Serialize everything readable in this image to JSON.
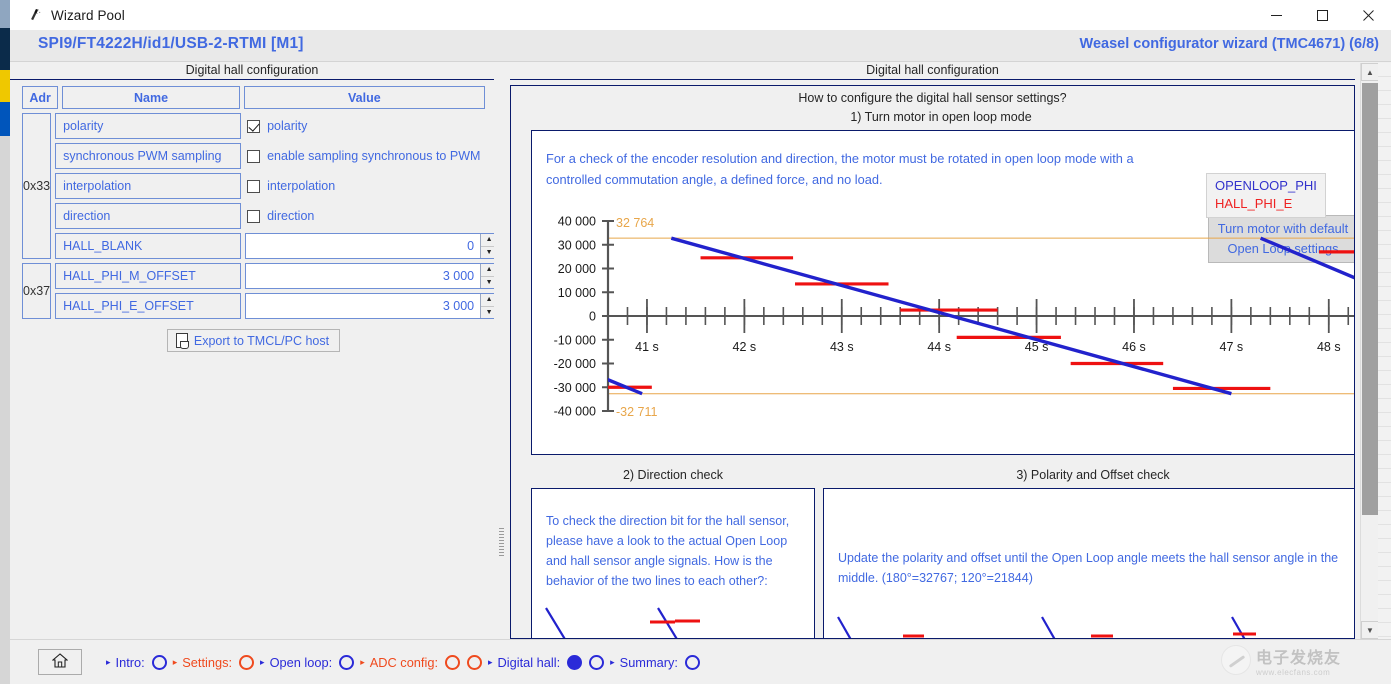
{
  "window": {
    "title": "Wizard Pool",
    "icon": "wand-icon",
    "minimize": "—",
    "maximize": "☐",
    "close": "✕"
  },
  "header": {
    "device": "SPI9/FT4222H/id1/USB-2-RTMI [M1]",
    "wizard": "Weasel configurator wizard (TMC4671) (6/8)"
  },
  "left_panel": {
    "group_title": "Digital hall configuration",
    "columns": {
      "adr": "Adr",
      "name": "Name",
      "value": "Value"
    },
    "groups": [
      {
        "adr": "0x33",
        "rows": [
          {
            "name": "polarity",
            "type": "checkbox",
            "label": "polarity",
            "checked": true
          },
          {
            "name": "synchronous PWM sampling",
            "type": "checkbox",
            "label": "enable sampling synchronous to PWM",
            "checked": false
          },
          {
            "name": "interpolation",
            "type": "checkbox",
            "label": "interpolation",
            "checked": false
          },
          {
            "name": "direction",
            "type": "checkbox",
            "label": "direction",
            "checked": false
          },
          {
            "name": "HALL_BLANK",
            "type": "spin",
            "value": "0"
          }
        ]
      },
      {
        "adr": "0x37",
        "rows": [
          {
            "name": "HALL_PHI_M_OFFSET",
            "type": "spin",
            "value": "3 000"
          },
          {
            "name": "HALL_PHI_E_OFFSET",
            "type": "spin",
            "value": "3 000"
          }
        ]
      }
    ],
    "export_button": "Export to TMCL/PC host",
    "spin_up": "▲",
    "spin_down": "▼"
  },
  "right_panel": {
    "group_title": "Digital hall configuration",
    "how_title": "How to configure the digital hall sensor settings?",
    "section1": {
      "label": "1) Turn motor in open loop mode",
      "text": "For a check of the encoder resolution and direction, the motor must be rotated in open loop mode with a controlled commutation angle, a defined force, and no load.",
      "button_line1": "Turn motor with default",
      "button_line2": "Open Loop settings"
    },
    "section2": {
      "label": "2) Direction check",
      "text": "To check the direction bit for the hall sensor, please have a look to the actual Open Loop and hall sensor angle signals. How is the behavior of the two lines to each other?:"
    },
    "section3": {
      "label": "3) Polarity and Offset check",
      "text": "Update the polarity and offset until the Open Loop angle meets the hall sensor angle in the middle. (180°=32767; 120°=21844)"
    }
  },
  "chart_data": {
    "type": "line",
    "title": "",
    "xlabel": "",
    "ylabel": "",
    "ylim": [
      -40000,
      40000
    ],
    "yticks": [
      40000,
      30000,
      20000,
      10000,
      0,
      -10000,
      -20000,
      -30000,
      -40000
    ],
    "ytick_labels": [
      "40 000",
      "30 000",
      "20 000",
      "10 000",
      "0",
      "-10 000",
      "-20 000",
      "-30 000",
      "-40 000"
    ],
    "xlim": [
      40.6,
      48.3
    ],
    "xticks": [
      41,
      42,
      43,
      44,
      45,
      46,
      47,
      48
    ],
    "xtick_labels": [
      "41 s",
      "42 s",
      "43 s",
      "44 s",
      "45 s",
      "46 s",
      "47 s",
      "48 s"
    ],
    "minor_tick_step": 0.2,
    "grid": false,
    "legend_position": "top-right",
    "limit_lines": [
      {
        "value": 32764,
        "label": "32 764",
        "color": "#e8a64a"
      },
      {
        "value": -32711,
        "label": "-32 711",
        "color": "#e8a64a"
      }
    ],
    "series": [
      {
        "name": "OPENLOOP_PHI",
        "color": "#2222cc",
        "type": "sawtooth",
        "description": "Descending sawtooth ramp from +32764 to -32711, period ~2.33 s",
        "segments": [
          {
            "x0": 40.55,
            "y0": -26000,
            "x1": 40.95,
            "y1": -32711
          },
          {
            "x0": 41.25,
            "y0": 32764,
            "x1": 47.0,
            "y1": -32711
          },
          {
            "x0": 47.3,
            "y0": 32764,
            "x1": 48.3,
            "y1": 15500
          }
        ]
      },
      {
        "name": "HALL_PHI_E",
        "color": "#ee1111",
        "type": "step",
        "description": "Six-step hall angle staircase following the open loop ramp",
        "steps": [
          {
            "x0": 40.55,
            "x1": 41.05,
            "y": -30000
          },
          {
            "x0": 41.55,
            "x1": 42.5,
            "y": 24500
          },
          {
            "x0": 42.52,
            "x1": 43.48,
            "y": 13500
          },
          {
            "x0": 43.6,
            "x1": 44.6,
            "y": 2500
          },
          {
            "x0": 44.18,
            "x1": 45.25,
            "y": -9000
          },
          {
            "x0": 45.35,
            "x1": 46.3,
            "y": -20000
          },
          {
            "x0": 46.4,
            "x1": 47.4,
            "y": -30500
          },
          {
            "x0": 47.9,
            "x1": 48.3,
            "y": 27000
          }
        ]
      }
    ]
  },
  "statusbar": {
    "home_icon": "home-icon",
    "steps": [
      {
        "label": "Intro:",
        "arrow": "▸",
        "color": "#2a2ad8",
        "dots": [
          {
            "color": "#2a2ad8",
            "filled": false
          }
        ]
      },
      {
        "label": "Settings:",
        "arrow": "▸",
        "color": "#ef4a1e",
        "dots": [
          {
            "color": "#ef4a1e",
            "filled": false
          }
        ]
      },
      {
        "label": "Open loop:",
        "arrow": "▸",
        "color": "#2a2ad8",
        "dots": [
          {
            "color": "#2a2ad8",
            "filled": false
          }
        ]
      },
      {
        "label": "ADC config:",
        "arrow": "▸",
        "color": "#ef4a1e",
        "dots": [
          {
            "color": "#ef4a1e",
            "filled": false
          },
          {
            "color": "#ef4a1e",
            "filled": false
          }
        ]
      },
      {
        "label": "Digital hall:",
        "arrow": "▸",
        "color": "#2a2ad8",
        "dots": [
          {
            "color": "#2a2ad8",
            "filled": true
          },
          {
            "color": "#2a2ad8",
            "filled": false
          }
        ]
      },
      {
        "label": "Summary:",
        "arrow": "▸",
        "color": "#2a2ad8",
        "dots": [
          {
            "color": "#2a2ad8",
            "filled": false
          }
        ]
      }
    ]
  },
  "watermark": {
    "cn": "电子发烧友",
    "en": "www.elecfans.com"
  },
  "scrollbar": {
    "up": "▲",
    "down": "▼"
  }
}
